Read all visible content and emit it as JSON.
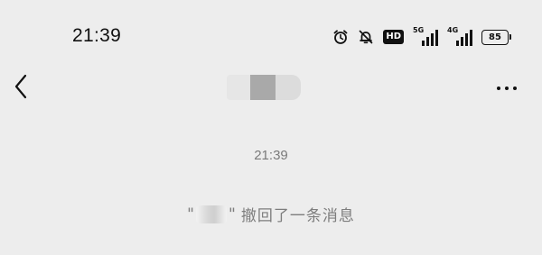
{
  "status_bar": {
    "time": "21:39",
    "icons": [
      "alarm-icon",
      "bell-off-icon",
      "hd-icon",
      "signal-5g-icon",
      "signal-4g-icon",
      "battery-icon"
    ],
    "hd_label": "HD",
    "network_1": "5G",
    "network_2": "4G",
    "battery_level": "85"
  },
  "nav": {
    "back_icon": "chevron-left-icon",
    "more_icon": "more-horizontal-icon"
  },
  "chat": {
    "timestamp": "21:39",
    "recall_open_quote": "\"",
    "recall_close_quote": "\"",
    "recall_text": "撤回了一条消息"
  }
}
